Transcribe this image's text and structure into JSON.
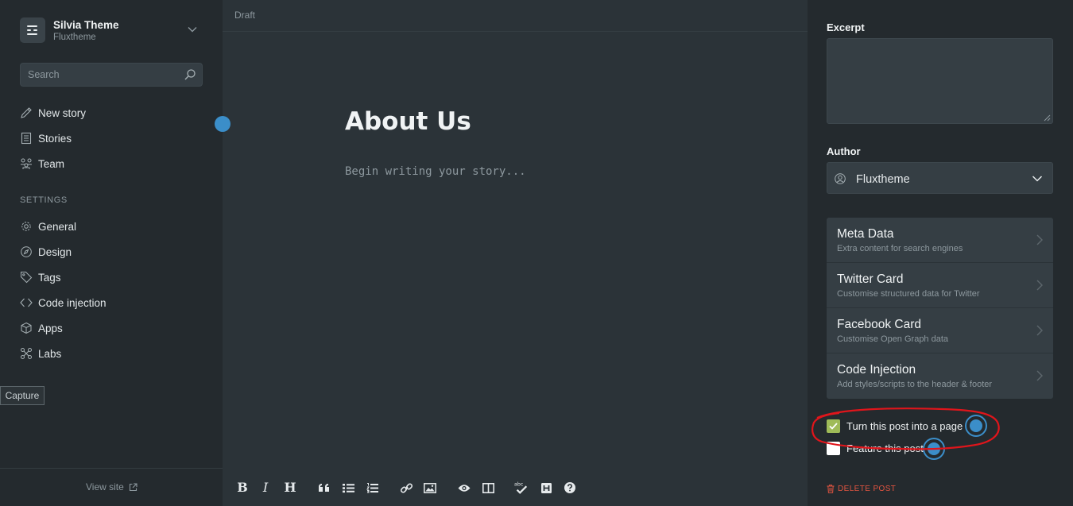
{
  "sidebar": {
    "brand_title": "Silvia Theme",
    "brand_subtitle": "Fluxtheme",
    "search_placeholder": "Search",
    "nav": [
      {
        "label": "New story",
        "icon": "pencil-icon"
      },
      {
        "label": "Stories",
        "icon": "document-list-icon"
      },
      {
        "label": "Team",
        "icon": "team-icon"
      }
    ],
    "settings_heading": "SETTINGS",
    "settings": [
      {
        "label": "General",
        "icon": "gear-icon"
      },
      {
        "label": "Design",
        "icon": "compass-icon"
      },
      {
        "label": "Tags",
        "icon": "tag-icon"
      },
      {
        "label": "Code injection",
        "icon": "code-icon"
      },
      {
        "label": "Apps",
        "icon": "box-icon"
      },
      {
        "label": "Labs",
        "icon": "labs-icon"
      }
    ],
    "view_site": "View site"
  },
  "tooltip": {
    "capture": "Capture"
  },
  "editor": {
    "status": "Draft",
    "title": "About Us",
    "body_placeholder": "Begin writing your story...",
    "toolbar": {
      "bold": "B",
      "italic": "I",
      "heading": "H"
    }
  },
  "panel": {
    "excerpt_label": "Excerpt",
    "excerpt_value": "",
    "author_label": "Author",
    "author_value": "Fluxtheme",
    "menu": [
      {
        "title": "Meta Data",
        "desc": "Extra content for search engines"
      },
      {
        "title": "Twitter Card",
        "desc": "Customise structured data for Twitter"
      },
      {
        "title": "Facebook Card",
        "desc": "Customise Open Graph data"
      },
      {
        "title": "Code Injection",
        "desc": "Add styles/scripts to the header & footer"
      }
    ],
    "page_toggle": {
      "label": "Turn this post into a page",
      "checked": true
    },
    "feature_toggle": {
      "label": "Feature this post",
      "checked": false
    },
    "delete_label": "DELETE POST"
  },
  "colors": {
    "accent_blue": "#3b8ec9",
    "checkbox_green": "#9fbb58",
    "delete_red": "#e25440",
    "annotation_red": "#e0151b"
  }
}
